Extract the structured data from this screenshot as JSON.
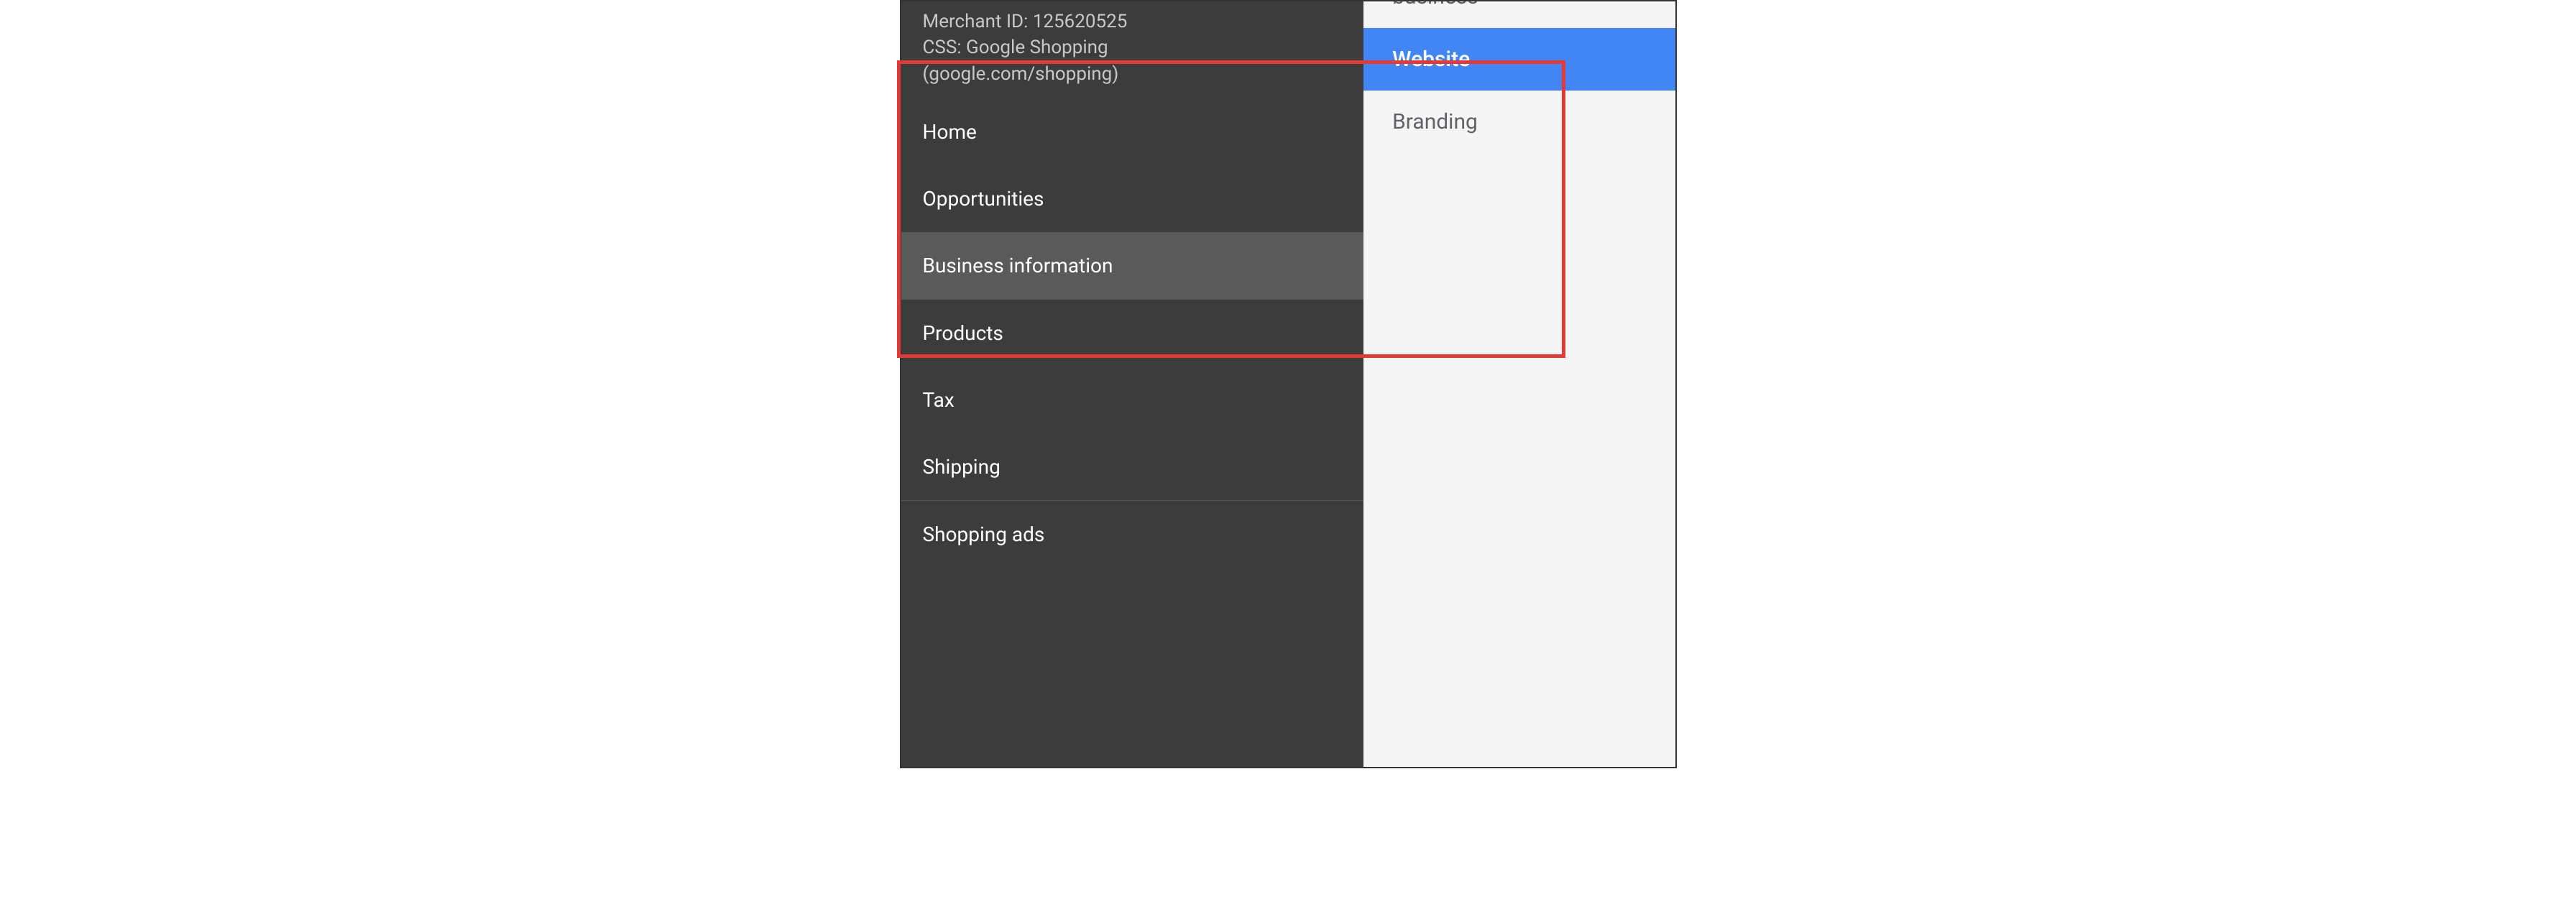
{
  "header": {
    "merchant_id_label": "Merchant ID: 125620525",
    "css_label": "CSS: Google Shopping",
    "css_url": "(google.com/shopping)"
  },
  "nav": {
    "group1": [
      {
        "label": "Home"
      },
      {
        "label": "Opportunities"
      },
      {
        "label": "Business information"
      }
    ],
    "group2": [
      {
        "label": "Products"
      },
      {
        "label": "Tax"
      },
      {
        "label": "Shipping"
      }
    ],
    "group3": [
      {
        "label": "Shopping ads"
      }
    ]
  },
  "submenu": {
    "items": [
      {
        "label": "business"
      },
      {
        "label": "Website"
      },
      {
        "label": "Branding"
      }
    ]
  }
}
